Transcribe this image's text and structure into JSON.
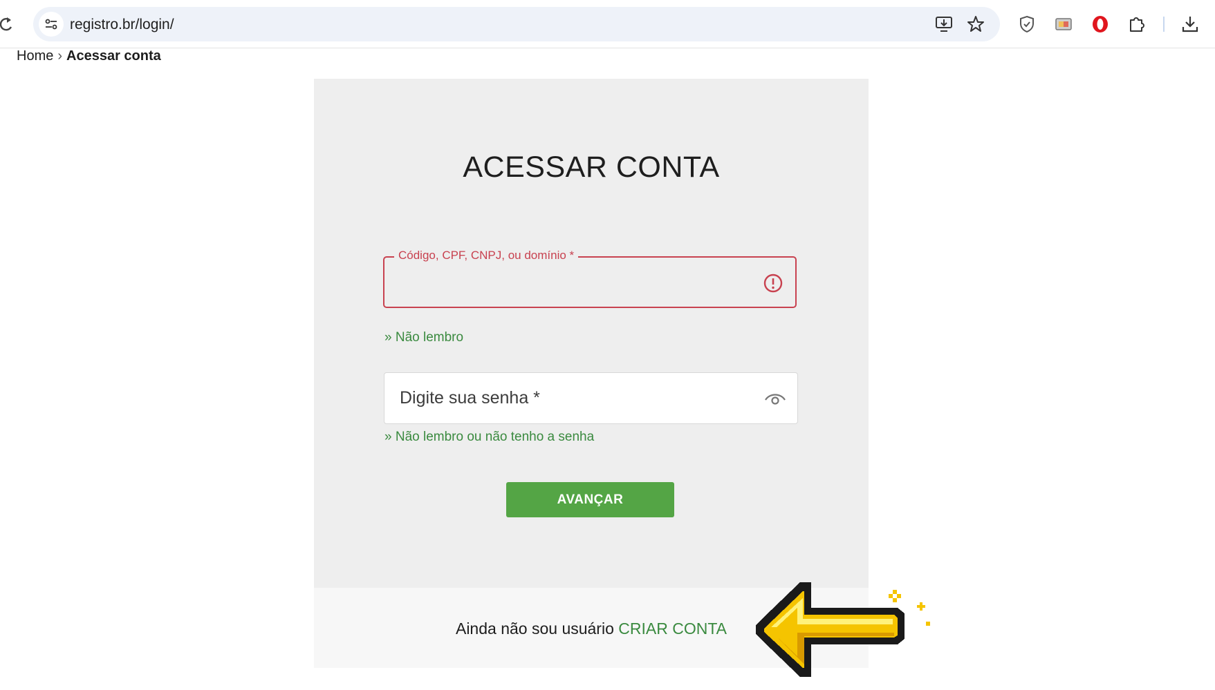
{
  "browser": {
    "url": "registro.br/login/",
    "icons": [
      "reload-icon",
      "site-info-icon",
      "install-app-icon",
      "bookmark-star-icon",
      "shield-extension-icon",
      "cast-extension-icon",
      "opera-extension-icon",
      "extensions-puzzle-icon",
      "download-icon"
    ]
  },
  "breadcrumb": {
    "home": "Home",
    "separator": "›",
    "current": "Acessar conta"
  },
  "login": {
    "title": "ACESSAR CONTA",
    "code_label": "Código, CPF, CNPJ, ou domínio *",
    "code_value": "",
    "forgot_code": "» Não lembro",
    "password_placeholder": "Digite sua senha *",
    "forgot_password": "» Não lembro ou não tenho a senha",
    "submit": "AVANÇAR"
  },
  "footer": {
    "prompt": "Ainda não sou usuário",
    "create_account": "CRIAR CONTA"
  },
  "colors": {
    "accent_green": "#54a545",
    "link_green": "#3a8a3f",
    "error_red": "#c8414f",
    "card_bg": "#eeeeee"
  }
}
